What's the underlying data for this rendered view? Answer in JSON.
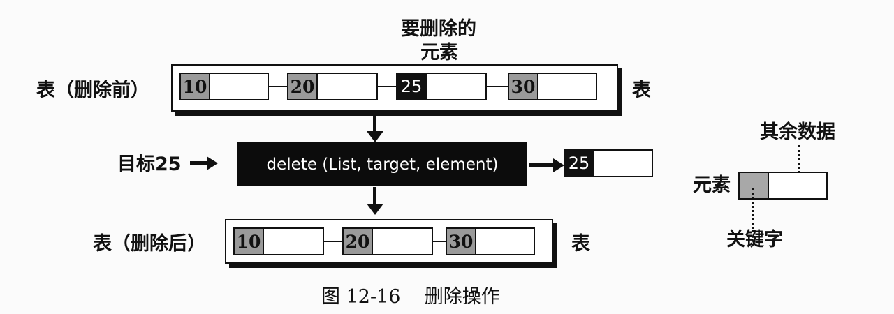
{
  "labels": {
    "element_to_delete_line1": "要删除的",
    "element_to_delete_line2": "元素",
    "list_before": "表（删除前）",
    "list_after": "表（删除后）",
    "list_right_top": "表",
    "list_right_bottom": "表",
    "target": "目标25",
    "function_call": "delete (List, target, element)",
    "legend_other_data": "其余数据",
    "legend_element": "元素",
    "legend_key": "关键字",
    "caption": "图 12-16    删除操作"
  },
  "list_before": {
    "keys": [
      "10",
      "20",
      "25",
      "30"
    ]
  },
  "list_after": {
    "keys": [
      "10",
      "20",
      "30"
    ]
  },
  "output_element": {
    "key": "25"
  },
  "colors": {
    "key_fill": "#9a9a9a",
    "highlight_fill": "#111111",
    "background": "#fbfbfb"
  }
}
